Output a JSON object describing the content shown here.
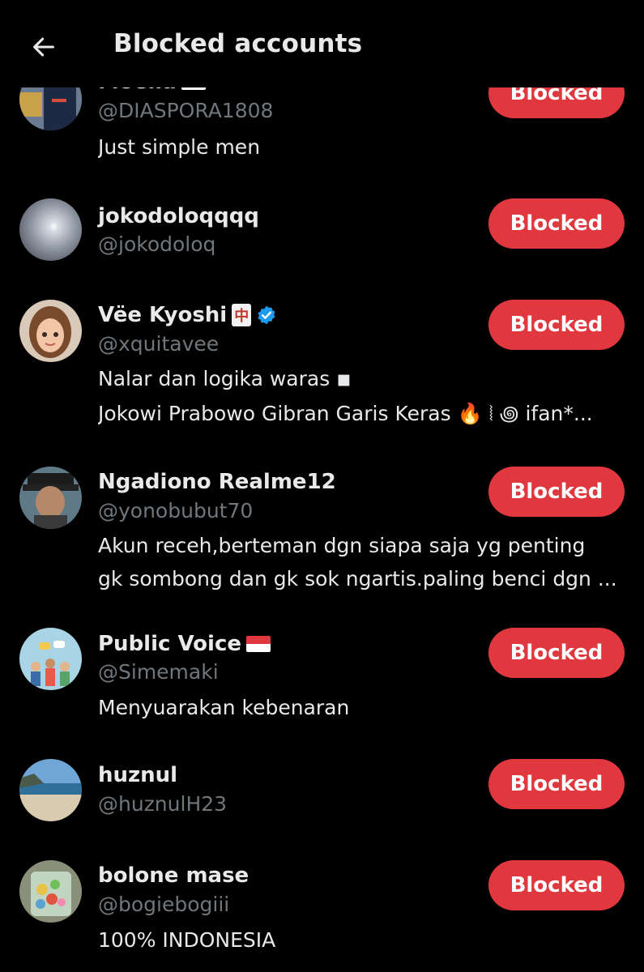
{
  "header": {
    "title": "Blocked accounts"
  },
  "accounts": [
    {
      "name": "Moelia",
      "handle": "@DIASPORA1808",
      "bio": "Just simple men",
      "button": "Blocked"
    },
    {
      "name": "jokodoloqqqq",
      "handle": "@jokodoloq",
      "button": "Blocked"
    },
    {
      "name": "Vëe Kyoshi",
      "handle": "@xquitavee",
      "bio1": "Nalar dan logika waras ◾",
      "bio2": "Jokowi Prabowo Gibran Garis Keras 🔥 ⦚ ꩜ ifan*...",
      "button": "Blocked",
      "name_emoji": "中"
    },
    {
      "name": "Ngadiono Realme12",
      "handle": "@yonobubut70",
      "bio1": "Akun receh,berteman dgn siapa saja yg penting",
      "bio2": "gk sombong dan gk sok ngartis.paling benci dgn ...",
      "button": "Blocked"
    },
    {
      "name": "Public Voice",
      "handle": "@Simemaki",
      "bio": "Menyuarakan kebenaran",
      "button": "Blocked"
    },
    {
      "name": "huznul",
      "handle": "@huznulH23",
      "button": "Blocked"
    },
    {
      "name": "bolone mase",
      "handle": "@bogiebogiii",
      "bio": "100% INDONESIA",
      "button": "Blocked"
    }
  ],
  "colors": {
    "accent": "#e0383e",
    "background": "#000000",
    "secondary_text": "#71767b",
    "verified": "#1d9bf0"
  }
}
